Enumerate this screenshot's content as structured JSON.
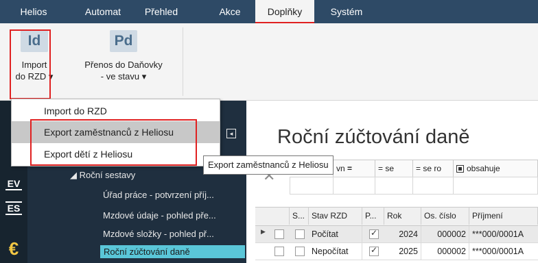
{
  "menu": {
    "tabs": [
      {
        "label": "Helios"
      },
      {
        "label": "Automat"
      },
      {
        "label": "Přehled"
      },
      {
        "label": "Akce"
      },
      {
        "label": "Doplňky"
      },
      {
        "label": "Systém"
      }
    ]
  },
  "ribbon": {
    "import_icon": "Id",
    "import_label_1": "Import",
    "import_label_2": "do RZD ▾",
    "prenos_icon": "Pd",
    "prenos_label_1": "Přenos do Daňovky",
    "prenos_label_2": "- ve stavu ▾"
  },
  "dropdown": {
    "items": [
      {
        "label": "Import do RZD"
      },
      {
        "label": "Export zaměstnanců z Heliosu"
      },
      {
        "label": "Export dětí z Heliosu"
      }
    ]
  },
  "tooltip": {
    "text": "Export zaměstnanců z Heliosu"
  },
  "sidebar": {
    "icons": [
      {
        "label": "EV"
      },
      {
        "label": "ES"
      },
      {
        "label": "€"
      }
    ],
    "tree": [
      {
        "label": "◢ Roční sestavy"
      },
      {
        "label": "Úřad práce - potvrzení příj..."
      },
      {
        "label": "Mzdové údaje - pohled pře..."
      },
      {
        "label": "Mzdové složky - pohled př..."
      },
      {
        "label": "Roční zúčtování daně"
      }
    ]
  },
  "main": {
    "title": "Roční zúčtování daně",
    "filters": [
      "vn",
      "= se",
      "= se ro",
      "obsahuje"
    ],
    "filter_icon": "✕",
    "columns": [
      "S...",
      "Stav RZD",
      "P...",
      "Rok",
      "Os. číslo",
      "Příjmení"
    ],
    "rows": [
      {
        "stav": "Počítat",
        "p": true,
        "rok": "2024",
        "os": "000002",
        "prijmeni": "***000/0001A"
      },
      {
        "stav": "Nepočítat",
        "p": true,
        "rok": "2025",
        "os": "000002",
        "prijmeni": "***000/0001A"
      }
    ]
  },
  "colors": {
    "menubar": "#2e4a66",
    "highlight_red": "#e02020",
    "selected_tree": "#5ac6d8",
    "sidebar_bg": "#1f2f3f"
  }
}
